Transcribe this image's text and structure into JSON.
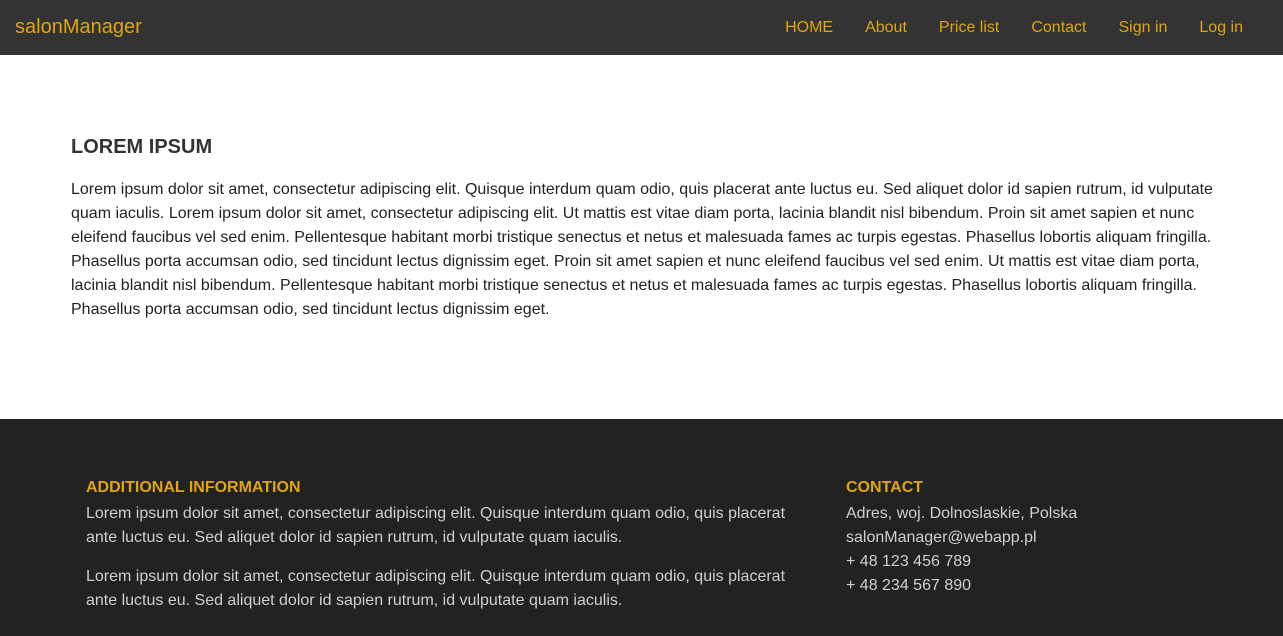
{
  "navbar": {
    "brand": "salonManager",
    "links": [
      {
        "label": "HOME"
      },
      {
        "label": "About"
      },
      {
        "label": "Price list"
      },
      {
        "label": "Contact"
      },
      {
        "label": "Sign in"
      },
      {
        "label": "Log in"
      }
    ]
  },
  "main": {
    "title": "LOREM IPSUM",
    "text": "Lorem ipsum dolor sit amet, consectetur adipiscing elit. Quisque interdum quam odio, quis placerat ante luctus eu. Sed aliquet dolor id sapien rutrum, id vulputate quam iaculis. Lorem ipsum dolor sit amet, consectetur adipiscing elit. Ut mattis est vitae diam porta, lacinia blandit nisl bibendum. Proin sit amet sapien et nunc eleifend faucibus vel sed enim. Pellentesque habitant morbi tristique senectus et netus et malesuada fames ac turpis egestas. Phasellus lobortis aliquam fringilla. Phasellus porta accumsan odio, sed tincidunt lectus dignissim eget. Proin sit amet sapien et nunc eleifend faucibus vel sed enim. Ut mattis est vitae diam porta, lacinia blandit nisl bibendum. Pellentesque habitant morbi tristique senectus et netus et malesuada fames ac turpis egestas. Phasellus lobortis aliquam fringilla. Phasellus porta accumsan odio, sed tincidunt lectus dignissim eget."
  },
  "footer": {
    "info": {
      "heading": "ADDITIONAL INFORMATION",
      "paragraphs": [
        "Lorem ipsum dolor sit amet, consectetur adipiscing elit. Quisque interdum quam odio, quis placerat ante luctus eu. Sed aliquet dolor id sapien rutrum, id vulputate quam iaculis.",
        "Lorem ipsum dolor sit amet, consectetur adipiscing elit. Quisque interdum quam odio, quis placerat ante luctus eu. Sed aliquet dolor id sapien rutrum, id vulputate quam iaculis."
      ]
    },
    "contact": {
      "heading": "CONTACT",
      "address": "Adres, woj. Dolnoslaskie, Polska",
      "email": "salonManager@webapp.pl",
      "phone1": "+ 48 123 456 789",
      "phone2": "+ 48 234 567 890"
    }
  },
  "colors": {
    "navbar_bg": "#333333",
    "footer_bg": "#222222",
    "accent": "#e0a50f"
  }
}
